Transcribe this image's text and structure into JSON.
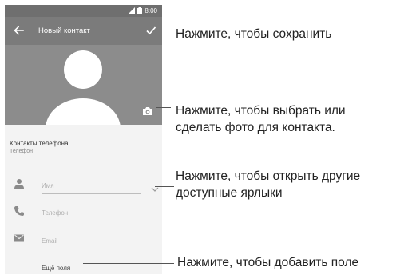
{
  "status_bar": {
    "time": "8:00",
    "icons": [
      "signal-icon",
      "battery-icon"
    ]
  },
  "toolbar": {
    "title": "Новый контакт",
    "back_icon": "arrow-back-icon",
    "save_icon": "check-icon"
  },
  "photo": {
    "avatar_icon": "person-silhouette-icon",
    "camera_icon": "camera-icon"
  },
  "account": {
    "title": "Контакты телефона",
    "subtitle": "Телефон"
  },
  "form": {
    "name_placeholder": "Имя",
    "phone_placeholder": "Телефон",
    "email_placeholder": "Email",
    "more_fields_label": "Ещё поля"
  },
  "callouts": {
    "save": "Нажмите, чтобы сохранить",
    "photo_line1": "Нажмите, чтобы выбрать или",
    "photo_line2": "сделать фото для контакта.",
    "labels_line1": "Нажмите, чтобы открыть другие",
    "labels_line2": "доступные ярлыки",
    "add_field": "Нажмите, чтобы добавить поле"
  },
  "colors": {
    "toolbar": "#7b7b7b",
    "status_bar": "#6f6f6f",
    "photo_background": "#8c8c8c",
    "screen_background": "#f3f3f3",
    "icon_gray": "#8a8a8a"
  }
}
